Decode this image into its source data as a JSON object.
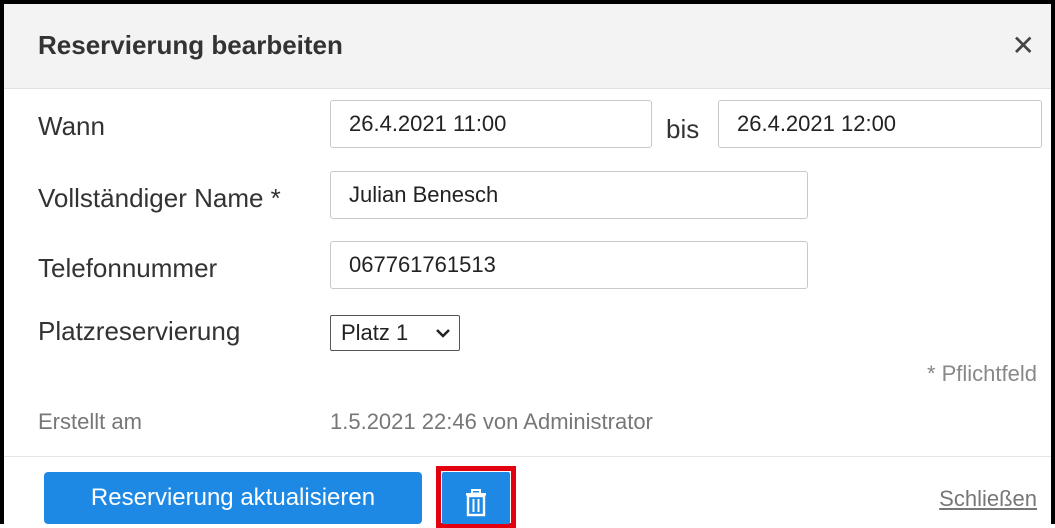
{
  "dialog": {
    "title": "Reservierung bearbeiten",
    "close_icon": "close-icon"
  },
  "form": {
    "when_label": "Wann",
    "start_value": "26.4.2021  11:00",
    "until_label": "bis",
    "end_value": "26.4.2021  12:00",
    "name_label": "Vollständiger Name *",
    "name_value": "Julian Benesch",
    "phone_label": "Telefonnummer",
    "phone_value": "067761761513",
    "seat_label": "Platzreservierung",
    "seat_value": "Platz 1",
    "required_hint": "* Pflichtfeld",
    "created_label": "Erstellt am",
    "created_value": "1.5.2021 22:46 von Administrator"
  },
  "footer": {
    "update_button": "Reservierung aktualisieren",
    "delete_icon": "trash-icon",
    "close_link": "Schließen"
  },
  "colors": {
    "primary": "#1e88e5",
    "highlight": "#e3000f",
    "header_bg": "#f3f3f3"
  }
}
